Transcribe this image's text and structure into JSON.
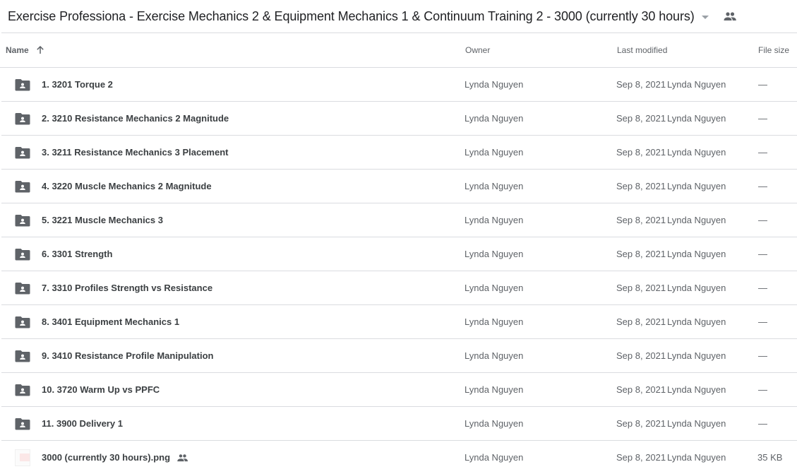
{
  "header": {
    "title": "Exercise Professiona - Exercise Mechanics 2 & Equipment Mechanics 1 & Continuum Training 2 - 3000 (currently 30 hours)",
    "title_dropdown_icon": "caret-down-icon",
    "shared_icon": "people-icon"
  },
  "columns": {
    "name": "Name",
    "name_sort_icon": "arrow-up-icon",
    "owner": "Owner",
    "last_modified": "Last modified",
    "file_size": "File size"
  },
  "files": [
    {
      "type": "shared-folder",
      "icon": "shared-folder-icon",
      "name": "1. 3201 Torque 2",
      "owner": "Lynda Nguyen",
      "modified_date": "Sep 8, 2021",
      "modified_by": "Lynda Nguyen",
      "size": "—"
    },
    {
      "type": "shared-folder",
      "icon": "shared-folder-icon",
      "name": "2. 3210 Resistance Mechanics 2 Magnitude",
      "owner": "Lynda Nguyen",
      "modified_date": "Sep 8, 2021",
      "modified_by": "Lynda Nguyen",
      "size": "—"
    },
    {
      "type": "shared-folder",
      "icon": "shared-folder-icon",
      "name": "3. 3211 Resistance Mechanics 3 Placement",
      "owner": "Lynda Nguyen",
      "modified_date": "Sep 8, 2021",
      "modified_by": "Lynda Nguyen",
      "size": "—"
    },
    {
      "type": "shared-folder",
      "icon": "shared-folder-icon",
      "name": "4. 3220 Muscle Mechanics 2 Magnitude",
      "owner": "Lynda Nguyen",
      "modified_date": "Sep 8, 2021",
      "modified_by": "Lynda Nguyen",
      "size": "—"
    },
    {
      "type": "shared-folder",
      "icon": "shared-folder-icon",
      "name": "5. 3221 Muscle Mechanics 3",
      "owner": "Lynda Nguyen",
      "modified_date": "Sep 8, 2021",
      "modified_by": "Lynda Nguyen",
      "size": "—"
    },
    {
      "type": "shared-folder",
      "icon": "shared-folder-icon",
      "name": "6. 3301 Strength",
      "owner": "Lynda Nguyen",
      "modified_date": "Sep 8, 2021",
      "modified_by": "Lynda Nguyen",
      "size": "—"
    },
    {
      "type": "shared-folder",
      "icon": "shared-folder-icon",
      "name": "7. 3310 Profiles Strength vs Resistance",
      "owner": "Lynda Nguyen",
      "modified_date": "Sep 8, 2021",
      "modified_by": "Lynda Nguyen",
      "size": "—"
    },
    {
      "type": "shared-folder",
      "icon": "shared-folder-icon",
      "name": "8. 3401 Equipment Mechanics 1",
      "owner": "Lynda Nguyen",
      "modified_date": "Sep 8, 2021",
      "modified_by": "Lynda Nguyen",
      "size": "—"
    },
    {
      "type": "shared-folder",
      "icon": "shared-folder-icon",
      "name": "9. 3410 Resistance Profile Manipulation",
      "owner": "Lynda Nguyen",
      "modified_date": "Sep 8, 2021",
      "modified_by": "Lynda Nguyen",
      "size": "—"
    },
    {
      "type": "shared-folder",
      "icon": "shared-folder-icon",
      "name": "10. 3720 Warm Up vs PPFC",
      "owner": "Lynda Nguyen",
      "modified_date": "Sep 8, 2021",
      "modified_by": "Lynda Nguyen",
      "size": "—"
    },
    {
      "type": "shared-folder",
      "icon": "shared-folder-icon",
      "name": "11. 3900 Delivery 1",
      "owner": "Lynda Nguyen",
      "modified_date": "Sep 8, 2021",
      "modified_by": "Lynda Nguyen",
      "size": "—"
    },
    {
      "type": "image",
      "icon": "image-thumbnail-icon",
      "name": "3000 (currently 30 hours).png",
      "shared": true,
      "shared_icon": "people-icon",
      "owner": "Lynda Nguyen",
      "modified_date": "Sep 8, 2021",
      "modified_by": "Lynda Nguyen",
      "size": "35 KB"
    }
  ],
  "colors": {
    "title_text": "#202124",
    "row_text": "#3c4043",
    "secondary_text": "#5f6368",
    "icon_gray": "#5f6368",
    "divider": "#dadce0"
  }
}
